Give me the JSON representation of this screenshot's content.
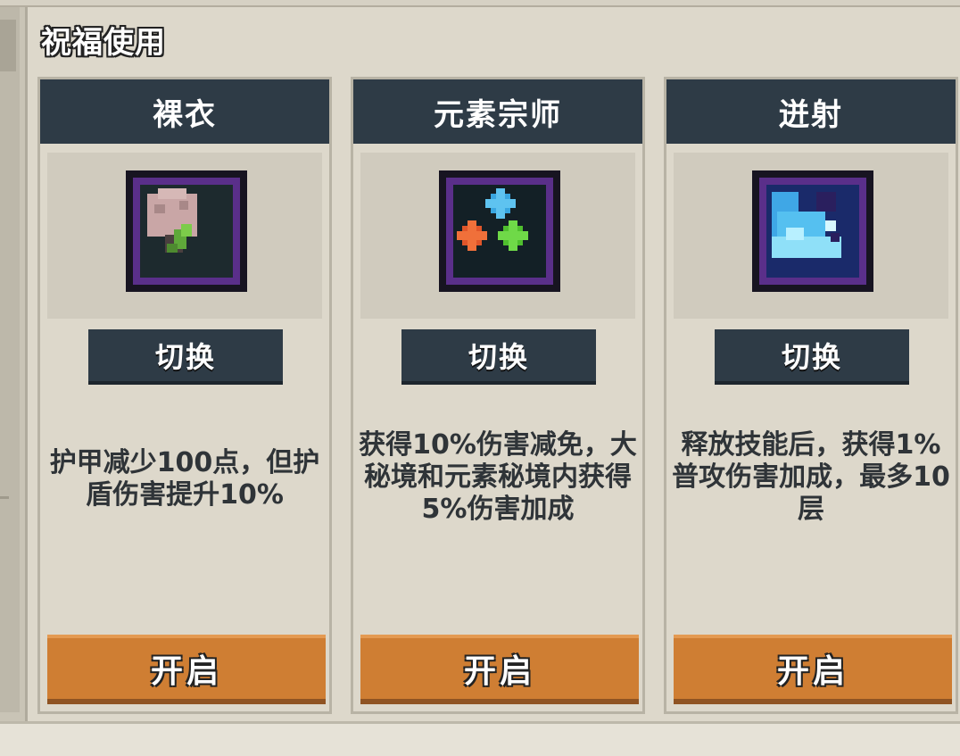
{
  "panel": {
    "title": "祝福使用"
  },
  "cards": [
    {
      "name": "裸衣",
      "icon": "pink-flower-icon",
      "switch_label": "切换",
      "description": "护甲减少100点，但护盾伤害提升10%",
      "open_label": "开启"
    },
    {
      "name": "元素宗师",
      "icon": "element-orbs-icon",
      "switch_label": "切换",
      "description": "获得10%伤害减免，大秘境和元素秘境内获得5%伤害加成",
      "open_label": "开启"
    },
    {
      "name": "迸射",
      "icon": "ice-burst-icon",
      "switch_label": "切换",
      "description": "释放技能后，获得1%普攻伤害加成，最多10层",
      "open_label": "开启"
    }
  ],
  "colors": {
    "header": "#2e3b46",
    "open_button": "#cf7e33",
    "icon_border": "#5a2f8a",
    "panel_bg": "#ddd8cb"
  }
}
